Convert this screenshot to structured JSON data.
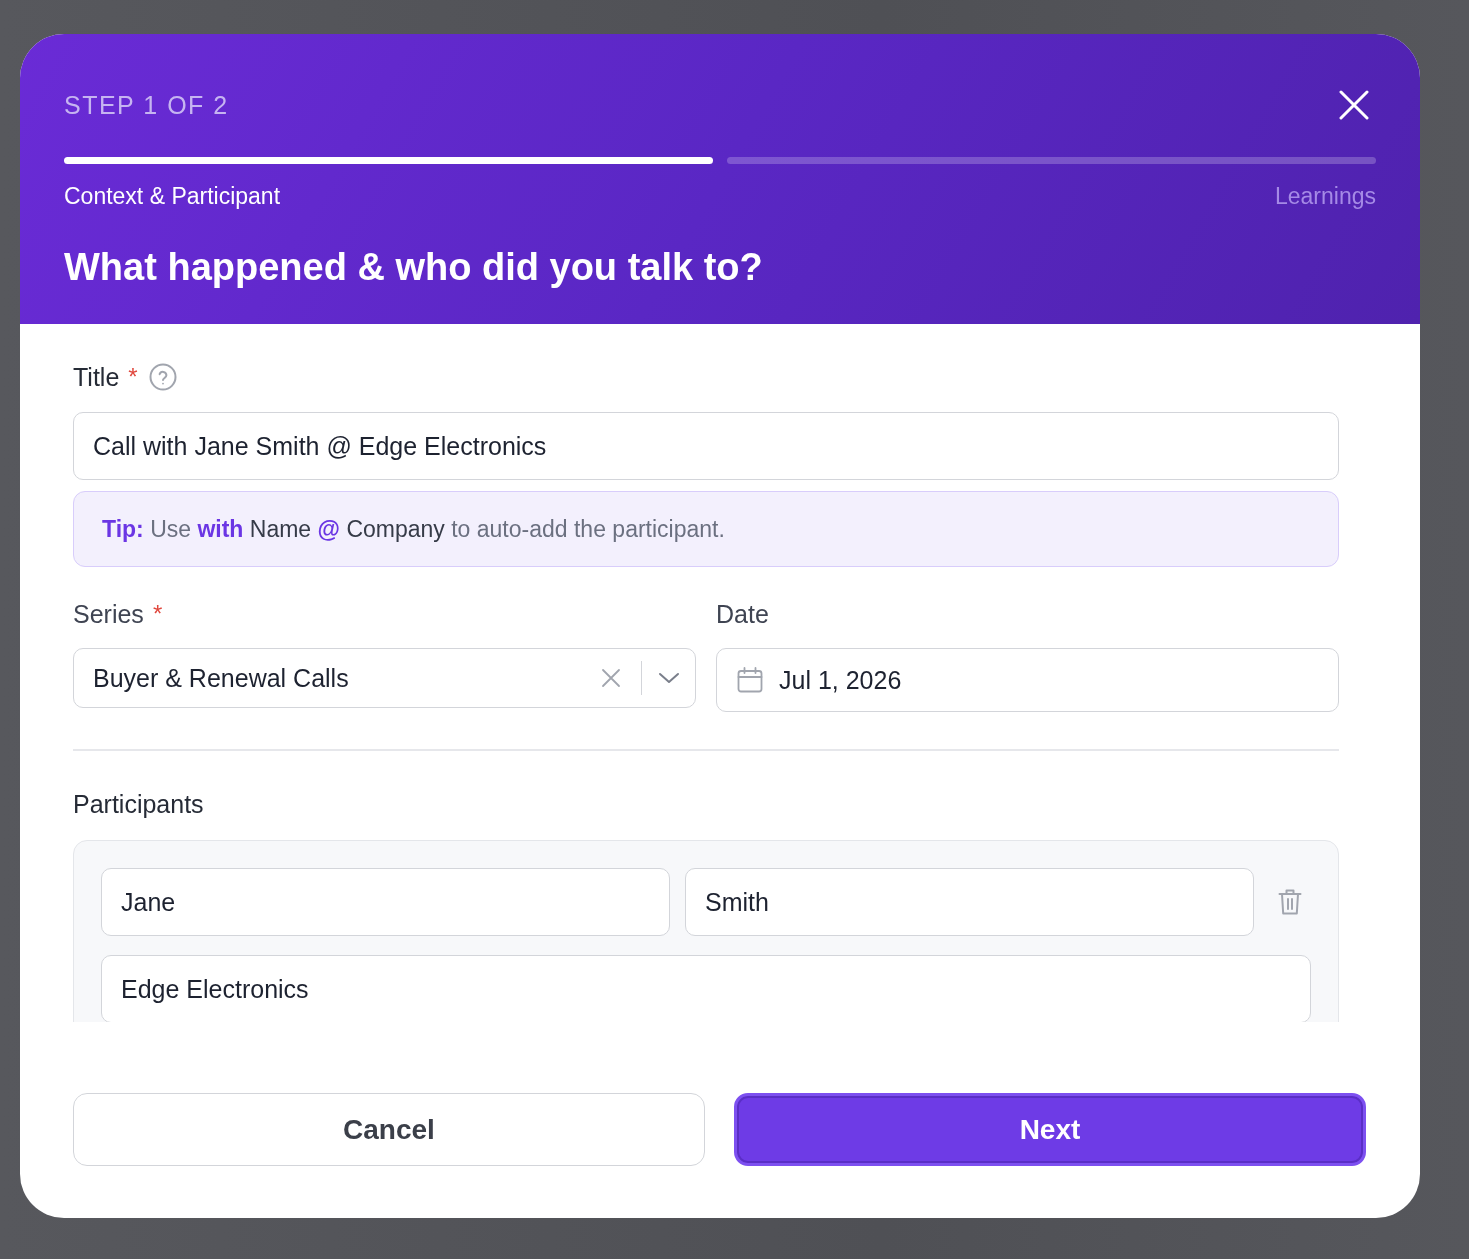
{
  "header": {
    "step": "STEP 1 OF 2",
    "steps": [
      {
        "label": "Context & Participant",
        "selected": true
      },
      {
        "label": "Learnings",
        "selected": false
      }
    ],
    "heading": "What happened & who did you talk to?"
  },
  "title_field": {
    "label": "Title",
    "required_mark": "*",
    "value": "Call with Jane Smith @ Edge Electronics"
  },
  "tip": [
    {
      "text": "Tip:",
      "kind": "emphasis"
    },
    {
      "text": "Use",
      "kind": "muted"
    },
    {
      "text": "with",
      "kind": "emphasis"
    },
    {
      "text": "Name",
      "kind": "strong"
    },
    {
      "text": "@",
      "kind": "emphasis"
    },
    {
      "text": "Company",
      "kind": "strong"
    },
    {
      "text": "to auto-add the participant.",
      "kind": "muted"
    }
  ],
  "series_field": {
    "label": "Series",
    "required_mark": "*",
    "value": "Buyer & Renewal Calls"
  },
  "date_field": {
    "label": "Date",
    "value": "Jul 1, 2026"
  },
  "participants": {
    "label": "Participants",
    "items": [
      {
        "first_name": "Jane",
        "last_name": "Smith",
        "company": "Edge Electronics"
      }
    ]
  },
  "buttons": [
    {
      "label": "Cancel",
      "kind": "secondary"
    },
    {
      "label": "Next",
      "kind": "primary"
    }
  ]
}
